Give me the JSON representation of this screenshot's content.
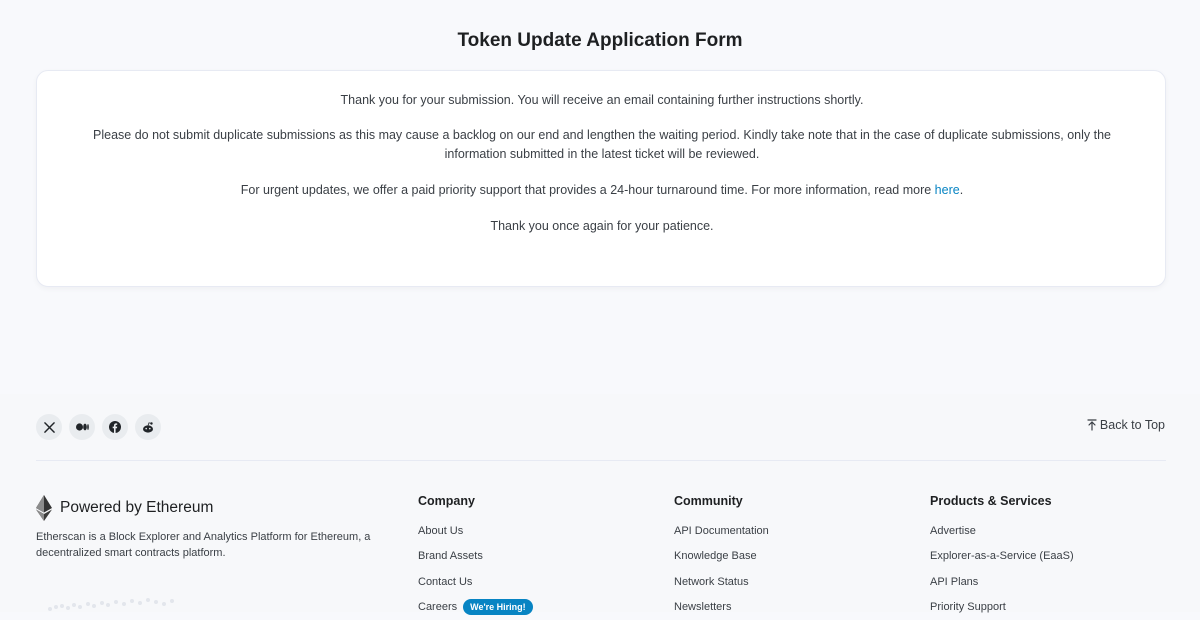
{
  "page": {
    "title": "Token Update Application Form"
  },
  "message": {
    "line1": "Thank you for your submission. You will receive an email containing further instructions shortly.",
    "line2": "Please do not submit duplicate submissions as this may cause a backlog on our end and lengthen the waiting period. Kindly take note that in the case of duplicate submissions, only the information submitted in the latest ticket will be reviewed.",
    "line3_prefix": "For urgent updates, we offer a paid priority support that provides a 24-hour turnaround time. For more information, read more ",
    "line3_link": "here",
    "line3_suffix": ".",
    "line4": "Thank you once again for your patience."
  },
  "footer": {
    "social": [
      "x-icon",
      "medium-icon",
      "facebook-icon",
      "reddit-icon"
    ],
    "back_to_top": "Back to Top",
    "brand": {
      "powered_by": "Powered by Ethereum",
      "description": "Etherscan is a Block Explorer and Analytics Platform for Ethereum, a decentralized smart contracts platform."
    },
    "columns": [
      {
        "heading": "Company",
        "links": [
          "About Us",
          "Brand Assets",
          "Contact Us",
          "Careers"
        ],
        "badge": "We're Hiring!"
      },
      {
        "heading": "Community",
        "links": [
          "API Documentation",
          "Knowledge Base",
          "Network Status",
          "Newsletters"
        ]
      },
      {
        "heading": "Products & Services",
        "links": [
          "Advertise",
          "Explorer-as-a-Service (EaaS)",
          "API Plans",
          "Priority Support"
        ]
      }
    ]
  },
  "colors": {
    "link": "#0784c3",
    "badge": "#0784c3",
    "page_bg": "#f8f9fc"
  }
}
